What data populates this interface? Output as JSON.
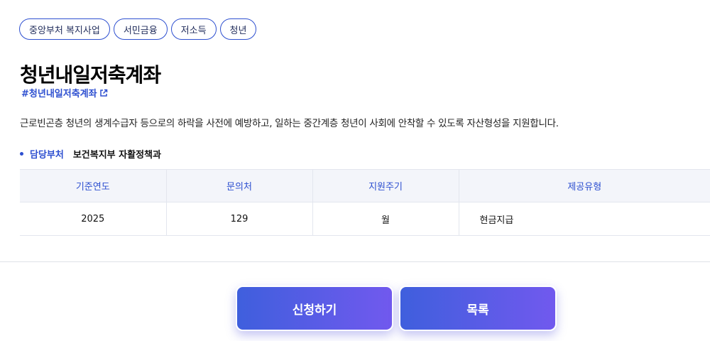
{
  "tags": [
    "중앙부처 복지사업",
    "서민금융",
    "저소득",
    "청년"
  ],
  "title": "청년내일저축계좌",
  "hashtag": "#청년내일저축계좌",
  "description": "근로빈곤층 청년의 생계수급자 등으로의 하락을 사전에 예방하고, 일하는 중간계층 청년이 사회에 안착할 수 있도록 자산형성을 지원합니다.",
  "department": {
    "label": "담당부처",
    "value": "보건복지부 자활정책과"
  },
  "table": {
    "headers": [
      "기준연도",
      "문의처",
      "지원주기",
      "제공유형"
    ],
    "row": [
      "2025",
      "129",
      "월",
      "현금지급"
    ]
  },
  "buttons": {
    "apply": "신청하기",
    "list": "목록"
  },
  "colors": {
    "accent": "#2d4fd0",
    "button_gradient_start": "#3f5fdd",
    "button_gradient_end": "#7159ee"
  },
  "icons": {
    "hashtag_link": "external-link-icon"
  }
}
